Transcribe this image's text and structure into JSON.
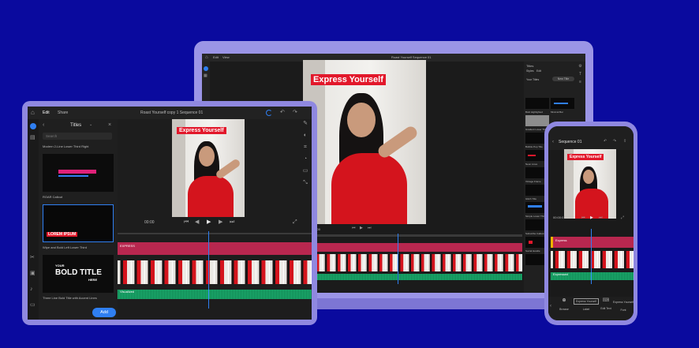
{
  "tablet": {
    "tabs": [
      "Edit",
      "Share"
    ],
    "project_title": "Roast Yourself copy 1 Sequence 01",
    "panel_title": "Titles",
    "search_placeholder": "Search",
    "top_caption": "Modern 2-Line Lower Third Right",
    "items": [
      {
        "caption": "ROAR Callout",
        "card_text": ""
      },
      {
        "caption": "Wipe and Bold Left Lower Third",
        "card_text": "LOREM IPSUM"
      },
      {
        "caption": "Three Line Bold Title with Accent Lines",
        "card_text_1": "YOUR",
        "card_text_2": "BOLD TITLE",
        "card_text_3": "HERE"
      }
    ],
    "add_button": "Add",
    "video_title": "Express Yourself",
    "timecode": "00:00",
    "track_pink_label": "EXPRESS",
    "track_green_label": "Visualized"
  },
  "laptop": {
    "menu": [
      "Edit",
      "View"
    ],
    "window_title": "Roast Yourself Sequence 01",
    "video_title": "Express Yourself",
    "timecode": "00:00",
    "panel_title": "Titles",
    "panel_tabs": [
      "Styles",
      "Edit"
    ],
    "panel_button": "New Title",
    "panel_label": "Your Titles",
    "thumbnails": [
      "Bold Highlighted",
      "Minimal Bar",
      "Gradient Lower Third",
      "Bubble Pop Title",
      "Neon Lines",
      "Vintage Frame",
      "Glitch Title",
      "Simple Lower Third",
      "Subscribe Callout",
      "Social Handle"
    ]
  },
  "phone": {
    "title": "Sequence 01",
    "video_title": "Express Yourself",
    "timecode": "00:00:01",
    "track_pink_label": "Express",
    "track_green_label": "Expressed",
    "bottom_items": [
      "Browse",
      "Express Yourself",
      "Edit Text",
      "Express Yourself"
    ],
    "bottom_labels": [
      "Browse",
      "Label",
      "Edit Text",
      "Font"
    ]
  },
  "colors": {
    "background": "#0a0a9e",
    "frame": "#9b95e6",
    "accent_red": "#e2182b",
    "accent_blue": "#2f7ff2",
    "track_pink": "#b8274f",
    "track_green": "#0f7f4e"
  }
}
